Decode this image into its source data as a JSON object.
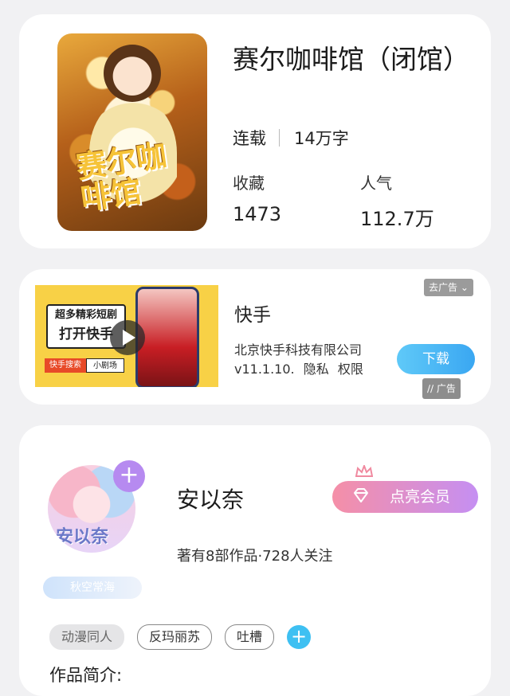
{
  "book": {
    "cover_title": "赛尔咖啡馆",
    "title": "赛尔咖啡馆（闭馆）",
    "status": "连载",
    "word_count": "14万字",
    "favorites_label": "收藏",
    "favorites_value": "1473",
    "popularity_label": "人气",
    "popularity_value": "112.7万"
  },
  "ad": {
    "banner_line1": "超多精彩短剧",
    "banner_line2": "打开快手",
    "banner_search_tag": "快手搜索",
    "banner_search_term": "小剧场",
    "close_label": "去广告",
    "app_name": "快手",
    "company": "北京快手科技有限公司",
    "version": "v11.1.10.",
    "privacy_label": "隐私",
    "permission_label": "权限",
    "download_label": "下载",
    "ad_tag": "广告"
  },
  "author": {
    "name": "安以奈",
    "avatar_text": "安以奈",
    "stats": "著有8部作品·728人关注",
    "fan_badge": "秋空常海",
    "vip_button": "点亮会员",
    "follow_symbol": "+",
    "tags": [
      "动漫同人",
      "反玛丽苏",
      "吐槽"
    ],
    "tag_add_symbol": "+",
    "intro_label": "作品简介:"
  }
}
